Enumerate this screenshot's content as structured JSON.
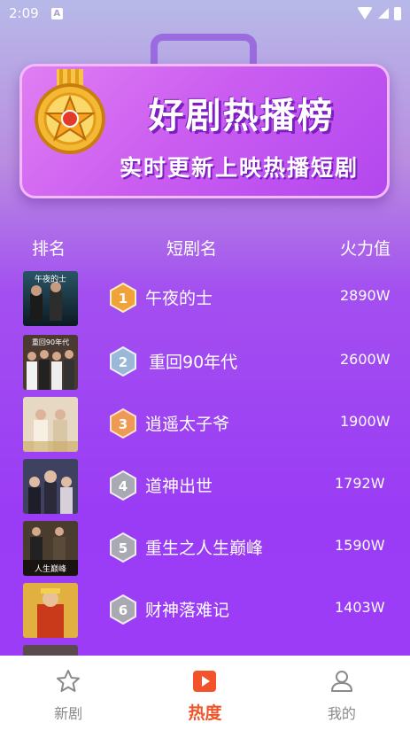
{
  "status_bar": {
    "time": "2:09",
    "notification_icon": "A"
  },
  "banner": {
    "title": "好剧热播榜",
    "subtitle": "实时更新上映热播短剧"
  },
  "table_header": {
    "rank": "排名",
    "name": "短剧名",
    "heat": "火力值"
  },
  "rankings": [
    {
      "rank": "1",
      "title": "午夜的士",
      "heat": "2890W",
      "badge_color": "#f2a23a",
      "thumb_colors": [
        "#1d3e4a",
        "#0c1a22"
      ],
      "thumb_text": "午夜的士"
    },
    {
      "rank": "2",
      "title": "重回90年代",
      "heat": "2600W",
      "badge_color": "#9bb8d8",
      "thumb_colors": [
        "#6a4a3a",
        "#2b1f1a"
      ],
      "thumb_text": "重回90年代"
    },
    {
      "rank": "3",
      "title": "逍遥太子爷",
      "heat": "1900W",
      "badge_color": "#ee9a55",
      "thumb_colors": [
        "#e8dccb",
        "#c9b79a"
      ],
      "thumb_text": ""
    },
    {
      "rank": "4",
      "title": "道神出世",
      "heat": "1792W",
      "badge_color": "#a9a9b3",
      "thumb_colors": [
        "#4b4f6b",
        "#1f2033"
      ],
      "thumb_text": ""
    },
    {
      "rank": "5",
      "title": "重生之人生巅峰",
      "heat": "1590W",
      "badge_color": "#a9a9b3",
      "thumb_colors": [
        "#5a4a3a",
        "#2a2018"
      ],
      "thumb_text": "人生巅峰"
    },
    {
      "rank": "6",
      "title": "财神落难记",
      "heat": "1403W",
      "badge_color": "#a9a9b3",
      "thumb_colors": [
        "#d8a030",
        "#8a2a10"
      ],
      "thumb_text": ""
    }
  ],
  "tabs": [
    {
      "label": "新剧",
      "icon": "star-icon",
      "active": false
    },
    {
      "label": "热度",
      "icon": "play-icon",
      "active": true
    },
    {
      "label": "我的",
      "icon": "user-icon",
      "active": false
    }
  ],
  "colors": {
    "accent": "#f2532a",
    "background_purple": "#9d3df7",
    "banner_pink": "#d869f2"
  }
}
